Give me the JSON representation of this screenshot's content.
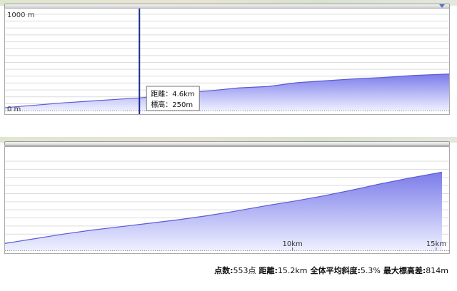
{
  "chart_data": [
    {
      "type": "area",
      "x_unit": "km",
      "xlim": [
        0,
        15.2
      ],
      "ylim": [
        0,
        1000
      ],
      "y_tick_labels": [
        "1000 m",
        "0 m"
      ],
      "x": [
        0,
        1,
        2,
        3,
        4,
        4.6,
        5,
        6,
        7,
        8,
        9,
        10,
        11,
        12,
        13,
        14,
        15.2
      ],
      "values": [
        30,
        55,
        80,
        100,
        120,
        130,
        145,
        180,
        205,
        235,
        250,
        290,
        310,
        330,
        345,
        365,
        380
      ],
      "grid": true,
      "fill_color": "#7b7bea",
      "line_color": "#5a5ad6",
      "cursor": {
        "x": 4.6,
        "distance_label": "距離：4.6km",
        "elevation_label": "標高：250m"
      }
    },
    {
      "type": "area",
      "x_unit": "km",
      "xlim": [
        0,
        15.2
      ],
      "x_tick_labels": [
        {
          "x": 10,
          "label": "10km"
        },
        {
          "x": 15,
          "label": "15km"
        }
      ],
      "x": [
        0,
        1,
        2,
        3,
        4,
        5,
        6,
        7,
        8,
        9,
        10,
        11,
        12,
        13,
        14,
        15.2
      ],
      "values": [
        60,
        100,
        140,
        175,
        205,
        235,
        265,
        300,
        340,
        385,
        425,
        470,
        520,
        575,
        625,
        680
      ],
      "grid": true,
      "fill_color": "#7b7bea",
      "line_color": "#5a5ad6"
    }
  ],
  "stats": {
    "points_label": "点数:",
    "points_value": "553点",
    "distance_label": "距離:",
    "distance_value": "15.2km",
    "slope_label": "全体平均斜度:",
    "slope_value": "5.3%",
    "elev_diff_label": "最大標高差:",
    "elev_diff_value": "814m"
  }
}
